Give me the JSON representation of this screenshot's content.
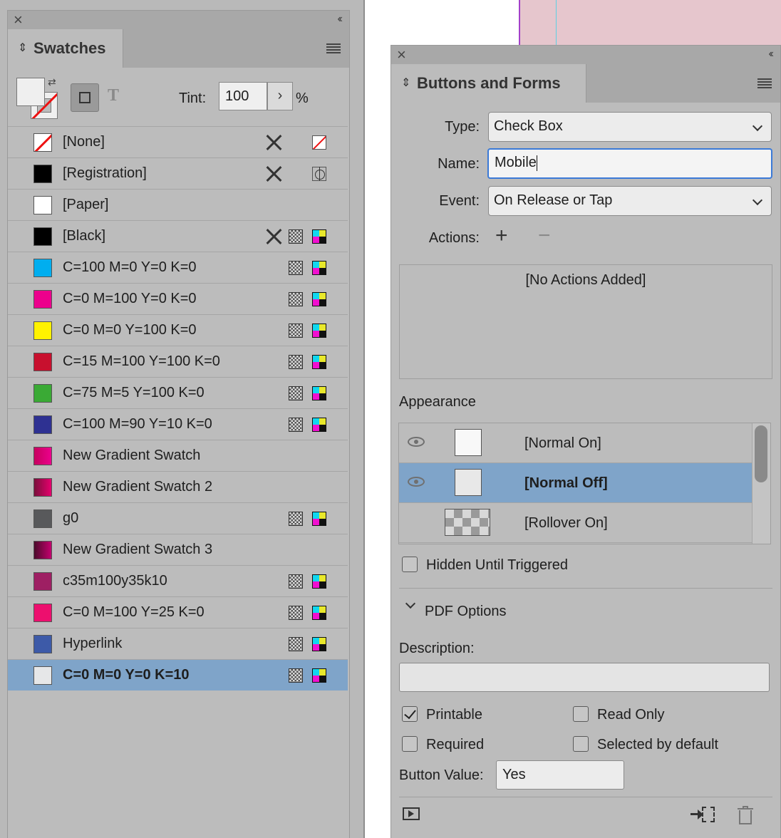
{
  "colors": {
    "selection": "#7fa4c9",
    "panel": "#bcbcbc",
    "document_pink": "#e6c6cd",
    "focus_blue": "#3b7ad7"
  },
  "swatches_panel": {
    "title": "Swatches",
    "tint_label": "Tint:",
    "tint_value": "100",
    "tint_unit": "%",
    "text_icon": "T",
    "swatches": [
      {
        "name": "[None]",
        "color": "none",
        "locked": true,
        "mode": "none"
      },
      {
        "name": "[Registration]",
        "color": "#000000",
        "locked": true,
        "mode": "registration"
      },
      {
        "name": "[Paper]",
        "color": "#ffffff",
        "locked": false,
        "mode": ""
      },
      {
        "name": "[Black]",
        "color": "#000000",
        "locked": true,
        "mode": "cmyk"
      },
      {
        "name": "C=100 M=0 Y=0 K=0",
        "color": "#00aeef",
        "locked": false,
        "mode": "cmyk"
      },
      {
        "name": "C=0 M=100 Y=0 K=0",
        "color": "#ec008c",
        "locked": false,
        "mode": "cmyk"
      },
      {
        "name": "C=0 M=0 Y=100 K=0",
        "color": "#fff200",
        "locked": false,
        "mode": "cmyk"
      },
      {
        "name": "C=15 M=100 Y=100 K=0",
        "color": "#c8102e",
        "locked": false,
        "mode": "cmyk"
      },
      {
        "name": "C=75 M=5 Y=100 K=0",
        "color": "#3aaa35",
        "locked": false,
        "mode": "cmyk"
      },
      {
        "name": "C=100 M=90 Y=10 K=0",
        "color": "#2e3192",
        "locked": false,
        "mode": "cmyk"
      },
      {
        "name": "New Gradient Swatch",
        "color": "gradient-magenta",
        "locked": false,
        "mode": ""
      },
      {
        "name": "New Gradient Swatch 2",
        "color": "gradient-magenta-dark",
        "locked": false,
        "mode": ""
      },
      {
        "name": "g0",
        "color": "#58595b",
        "locked": false,
        "mode": "cmyk"
      },
      {
        "name": "New Gradient Swatch 3",
        "color": "gradient-darkmagenta",
        "locked": false,
        "mode": ""
      },
      {
        "name": "c35m100y35k10",
        "color": "#9e1f63",
        "locked": false,
        "mode": "cmyk"
      },
      {
        "name": "C=0 M=100 Y=25 K=0",
        "color": "#ed0f6e",
        "locked": false,
        "mode": "cmyk"
      },
      {
        "name": "Hyperlink",
        "color": "#3d5aa8",
        "locked": false,
        "mode": "cmyk"
      },
      {
        "name": "C=0 M=0 Y=0 K=10",
        "color": "#e6e7e8",
        "locked": false,
        "mode": "cmyk",
        "selected": true
      }
    ]
  },
  "bf_panel": {
    "title": "Buttons and Forms",
    "type_label": "Type:",
    "type_value": "Check Box",
    "name_label": "Name:",
    "name_value": "Mobile",
    "event_label": "Event:",
    "event_value": "On Release or Tap",
    "actions_label": "Actions:",
    "add_icon": "+",
    "remove_icon": "−",
    "no_actions": "[No Actions Added]",
    "appearance_label": "Appearance",
    "appearances": [
      {
        "label": "[Normal On]",
        "visible": true
      },
      {
        "label": "[Normal Off]",
        "visible": true,
        "selected": true
      },
      {
        "label": "[Rollover On]",
        "visible": false
      }
    ],
    "hidden_until_triggered": "Hidden Until Triggered",
    "pdf_options": "PDF Options",
    "description_label": "Description:",
    "description_value": "",
    "printable": "Printable",
    "read_only": "Read Only",
    "required": "Required",
    "selected_by_default": "Selected by default",
    "button_value_label": "Button Value:",
    "button_value": "Yes"
  }
}
